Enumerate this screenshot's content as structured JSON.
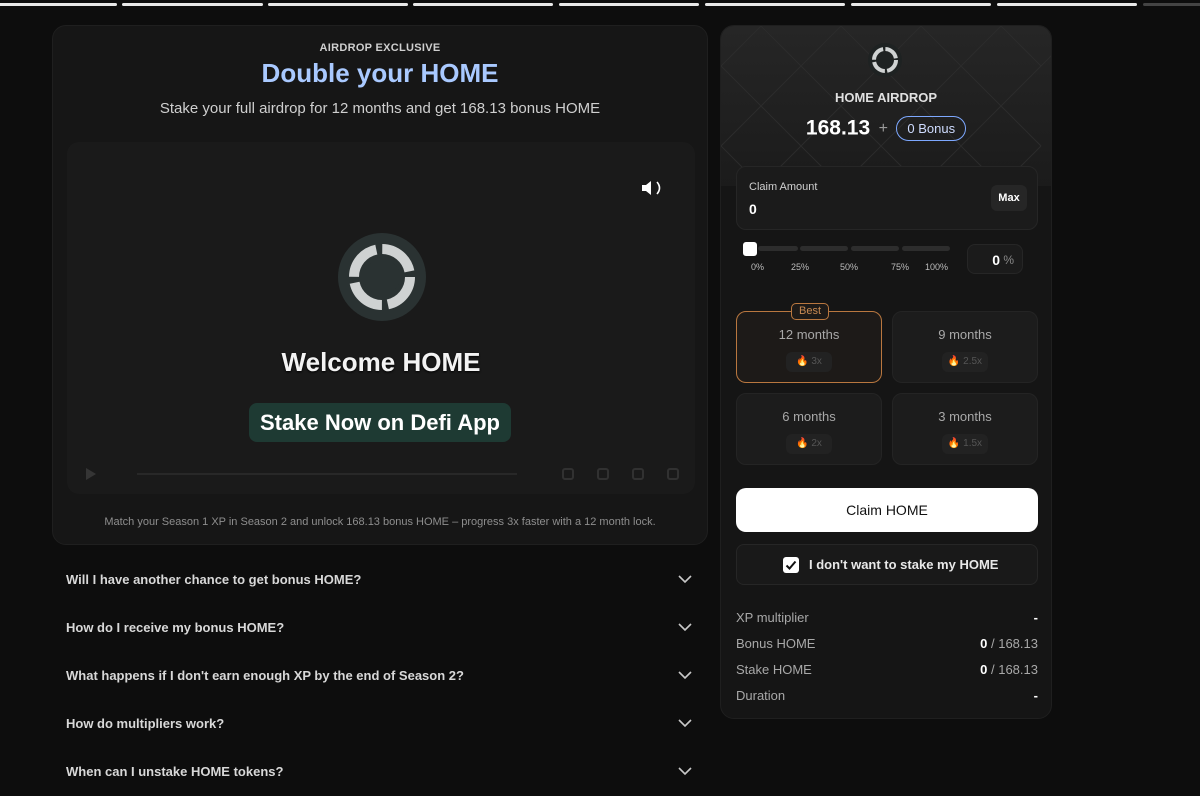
{
  "left": {
    "eyebrow": "AIRDROP EXCLUSIVE",
    "headline": "Double your HOME",
    "subline": "Stake your full airdrop for 12 months and get 168.13 bonus HOME",
    "video": {
      "welcome": "Welcome HOME",
      "cta": "Stake Now on Defi App"
    },
    "match_note": "Match your Season 1 XP in Season 2 and unlock 168.13 bonus HOME – progress 3x faster with a 12 month lock."
  },
  "faq": [
    {
      "q": "Will I have another chance to get bonus HOME?"
    },
    {
      "q": "How do I receive my bonus HOME?"
    },
    {
      "q": "What happens if I don't earn enough XP by the end of Season 2?"
    },
    {
      "q": "How do multipliers work?"
    },
    {
      "q": "When can I unstake HOME tokens?"
    }
  ],
  "right": {
    "title": "HOME AIRDROP",
    "amount": "168.13",
    "plus": "+",
    "bonus": "0 Bonus",
    "claim": {
      "label": "Claim Amount",
      "value": "0",
      "max": "Max"
    },
    "slider": {
      "ticks": [
        "0%",
        "25%",
        "50%",
        "75%",
        "100%"
      ],
      "value": "0",
      "unit": "%"
    },
    "options": [
      {
        "label": "12 months",
        "mult": "3x",
        "badge": "Best"
      },
      {
        "label": "9 months",
        "mult": "2.5x"
      },
      {
        "label": "6 months",
        "mult": "2x"
      },
      {
        "label": "3 months",
        "mult": "1.5x"
      }
    ],
    "claim_button": "Claim HOME",
    "no_stake": "I don't want to stake my HOME",
    "stats": [
      {
        "label": "XP multiplier",
        "val": "-",
        "total": ""
      },
      {
        "label": "Bonus HOME",
        "val": "0",
        "total": "/ 168.13"
      },
      {
        "label": "Stake HOME",
        "val": "0",
        "total": "/ 168.13"
      },
      {
        "label": "Duration",
        "val": "-",
        "total": ""
      }
    ]
  },
  "colors": {
    "accent": "#a9c9ff",
    "best": "#b9773f",
    "cta_bg": "#1e3a33"
  }
}
